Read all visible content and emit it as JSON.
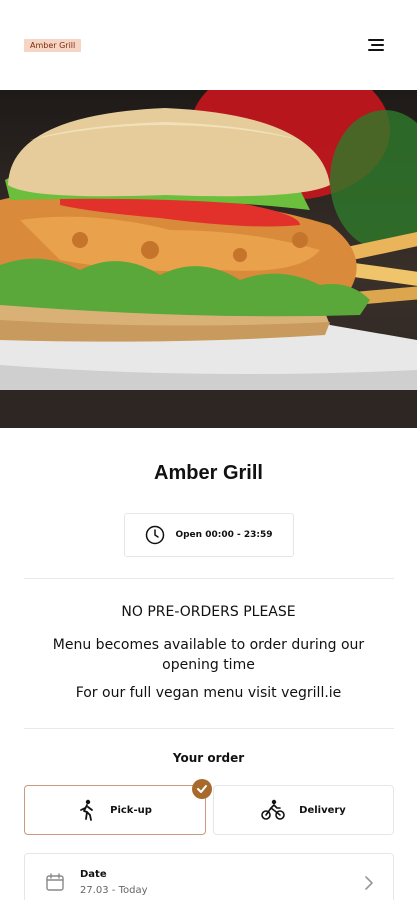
{
  "header": {
    "brand": "Amber Grill",
    "menu_icon": "hamburger-menu-icon"
  },
  "hero": {
    "image": "burger-photo"
  },
  "restaurant": {
    "name": "Amber Grill",
    "hours_icon": "clock-icon",
    "hours": "Open 00:00 - 23:59"
  },
  "notice": {
    "line1": "NO PRE-ORDERS PLEASE",
    "line2": "Menu becomes available to order during our opening time",
    "line3": "For our full vegan menu visit vegrill.ie"
  },
  "order": {
    "heading": "Your order",
    "options": [
      {
        "label": "Pick-up",
        "icon": "walking-person-icon",
        "selected": true
      },
      {
        "label": "Delivery",
        "icon": "cyclist-icon",
        "selected": false
      }
    ],
    "date": {
      "label": "Date",
      "value": "27.03 - Today",
      "icon": "calendar-icon"
    }
  },
  "colors": {
    "accent": "#a86a2c",
    "badge_bg": "#f6d5c4",
    "badge_text": "#7a2d10"
  }
}
